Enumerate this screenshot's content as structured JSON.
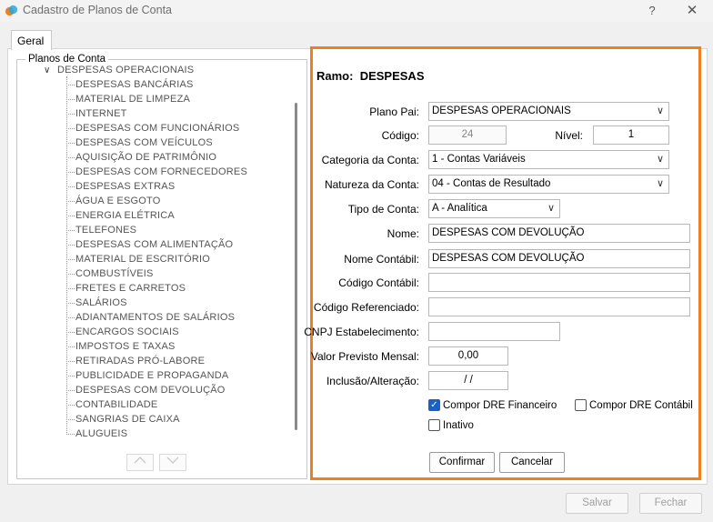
{
  "window": {
    "title": "Cadastro de Planos de Conta",
    "help": "?",
    "close": "✕"
  },
  "tabs": [
    {
      "label": "Geral"
    }
  ],
  "tree": {
    "legend": "Planos de Conta",
    "root": "DESPESAS OPERACIONAIS",
    "items": [
      "DESPESAS BANCÁRIAS",
      "MATERIAL DE LIMPEZA",
      "INTERNET",
      "DESPESAS COM FUNCIONÁRIOS",
      "DESPESAS COM VEÍCULOS",
      "AQUISIÇÃO DE PATRIMÔNIO",
      "DESPESAS COM FORNECEDORES",
      "DESPESAS EXTRAS",
      "ÁGUA E ESGOTO",
      "ENERGIA ELÉTRICA",
      "TELEFONES",
      "DESPESAS COM ALIMENTAÇÃO",
      "MATERIAL DE ESCRITÓRIO",
      "COMBUSTÍVEIS",
      "FRETES E CARRETOS",
      "SALÁRIOS",
      "ADIANTAMENTOS DE SALÁRIOS",
      "ENCARGOS SOCIAIS",
      "IMPOSTOS E TAXAS",
      "RETIRADAS PRÓ-LABORE",
      "PUBLICIDADE E PROPAGANDA",
      "DESPESAS COM DEVOLUÇÃO",
      "CONTABILIDADE",
      "SANGRIAS DE CAIXA",
      "ALUGUEIS"
    ]
  },
  "form": {
    "ramo_label": "Ramo:",
    "ramo_value": "DESPESAS",
    "plano_pai_label": "Plano Pai:",
    "plano_pai_value": "DESPESAS OPERACIONAIS",
    "codigo_label": "Código:",
    "codigo_value": "24",
    "nivel_label": "Nível:",
    "nivel_value": "1",
    "categoria_label": "Categoria da Conta:",
    "categoria_value": "1 - Contas Variáveis",
    "natureza_label": "Natureza da Conta:",
    "natureza_value": "04 - Contas de Resultado",
    "tipo_label": "Tipo de Conta:",
    "tipo_value": "A - Analítica",
    "nome_label": "Nome:",
    "nome_value": "DESPESAS COM DEVOLUÇÃO",
    "nome_contabil_label": "Nome Contábil:",
    "nome_contabil_value": "DESPESAS COM DEVOLUÇÃO",
    "codigo_contabil_label": "Código Contábil:",
    "codigo_contabil_value": "",
    "codigo_ref_label": "Código Referenciado:",
    "codigo_ref_value": "",
    "cnpj_label": "CNPJ Estabelecimento:",
    "cnpj_value": "",
    "valor_label": "Valor Previsto Mensal:",
    "valor_value": "0,00",
    "inclusao_label": "Inclusão/Alteração:",
    "inclusao_value": "/ /",
    "dre_financeiro_label": "Compor DRE Financeiro",
    "dre_financeiro_checked": true,
    "dre_contabil_label": "Compor DRE Contábil",
    "dre_contabil_checked": false,
    "inativo_label": "Inativo",
    "inativo_checked": false,
    "confirmar_label": "Confirmar",
    "cancelar_label": "Cancelar"
  },
  "footer": {
    "salvar_label": "Salvar",
    "fechar_label": "Fechar"
  },
  "colors": {
    "highlight_border": "#f0801f",
    "checkbox_checked": "#1a60c6"
  }
}
